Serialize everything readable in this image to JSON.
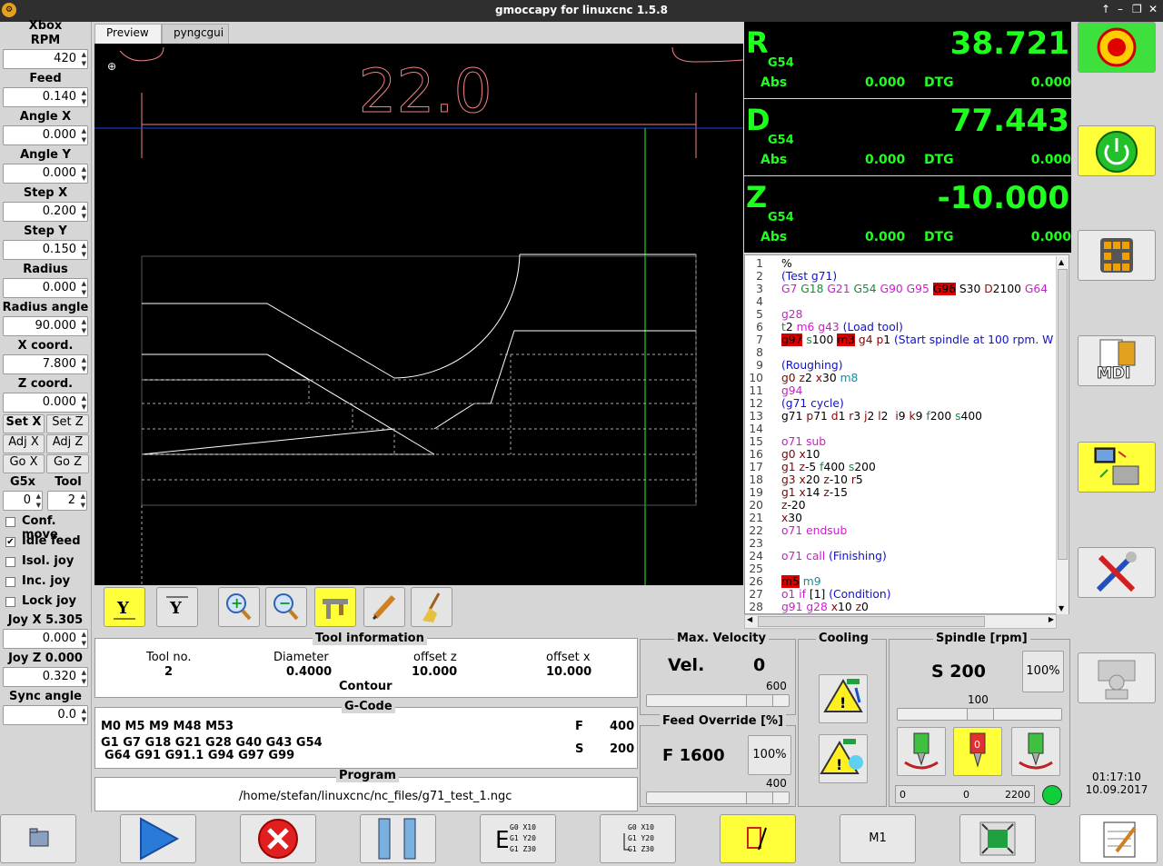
{
  "window": {
    "title": "gmoccapy for linuxcnc  1.5.8",
    "logo": "⚙",
    "controls": [
      "↑",
      "–",
      "❐",
      "✕"
    ]
  },
  "left": {
    "xbox": "Xbox",
    "rpm_label": "RPM",
    "rpm": "420",
    "feed_label": "Feed",
    "feed": "0.140",
    "anglex_label": "Angle X",
    "anglex": "0.000",
    "angley_label": "Angle Y",
    "angley": "0.000",
    "stepx_label": "Step X",
    "stepx": "0.200",
    "stepy_label": "Step Y",
    "stepy": "0.150",
    "radius_label": "Radius",
    "radius": "0.000",
    "radang_label": "Radius angle",
    "radang": "90.000",
    "xcoord_label": "X coord.",
    "xcoord": "7.800",
    "zcoord_label": "Z coord.",
    "zcoord": "0.000",
    "setx": "Set X",
    "setz": "Set Z",
    "adjx": "Adj X",
    "adjz": "Adj Z",
    "gox": "Go X",
    "goz": "Go Z",
    "g5x_label": "G5x",
    "g5x": "0",
    "tool_label": "Tool",
    "tool": "2",
    "conf": "Conf. move",
    "idle": "Idle feed",
    "isol": "Isol. joy",
    "inc": "Inc. joy",
    "lock": "Lock joy",
    "joyx_label": "Joy X 5.305",
    "joyx": "0.000",
    "joyz_label": "Joy Z 0.000",
    "joyz": "0.320",
    "sync_label": "Sync angle",
    "sync": "0.0"
  },
  "tabs": [
    "Preview",
    "pyngcgui"
  ],
  "preview": {
    "dimension": "22.0"
  },
  "dro": [
    {
      "axis": "R",
      "offset": "G54",
      "value": "38.721",
      "abs_label": "Abs",
      "abs": "0.000",
      "dtg_label": "DTG",
      "dtg": "0.000"
    },
    {
      "axis": "D",
      "offset": "G54",
      "value": "77.443",
      "abs_label": "Abs",
      "abs": "0.000",
      "dtg_label": "DTG",
      "dtg": "0.000"
    },
    {
      "axis": "Z",
      "offset": "G54",
      "value": "-10.000",
      "abs_label": "Abs",
      "abs": "0.000",
      "dtg_label": "DTG",
      "dtg": "0.000"
    }
  ],
  "gcode_lines": [
    [
      [
        "bk",
        "%"
      ]
    ],
    [
      [
        "bl",
        "(Test g71)"
      ]
    ],
    [
      [
        "mg",
        "G7 "
      ],
      [
        "gn",
        "G18 "
      ],
      [
        "mg",
        "G21 "
      ],
      [
        "gn",
        "G54 "
      ],
      [
        "mg",
        "G90 G95 "
      ],
      [
        "hl",
        "G96"
      ],
      [
        "bk",
        " S30 "
      ],
      [
        "rd",
        "D"
      ],
      [
        "bk",
        "2100 "
      ],
      [
        "mg",
        "G64"
      ]
    ],
    [],
    [
      [
        "mg",
        "g28"
      ]
    ],
    [
      [
        "gn",
        "t"
      ],
      [
        "bk",
        "2 "
      ],
      [
        "mg",
        "m6 g43 "
      ],
      [
        "bl",
        "(Load tool)"
      ]
    ],
    [
      [
        "hl",
        "g97"
      ],
      [
        "bk",
        " "
      ],
      [
        "gn",
        "s"
      ],
      [
        "bk",
        "100 "
      ],
      [
        "hl",
        "m3"
      ],
      [
        "bk",
        " "
      ],
      [
        "dr",
        "g4 p"
      ],
      [
        "bk",
        "1 "
      ],
      [
        "bl",
        "(Start spindle at 100 rpm. W"
      ]
    ],
    [],
    [
      [
        "bl",
        "(Roughing)"
      ]
    ],
    [
      [
        "dr",
        "g0 z"
      ],
      [
        "bk",
        "2 "
      ],
      [
        "dr",
        "x"
      ],
      [
        "bk",
        "30 "
      ],
      [
        "tl",
        "m8"
      ]
    ],
    [
      [
        "mg",
        "g94"
      ]
    ],
    [
      [
        "bl",
        "(g71 cycle)"
      ]
    ],
    [
      [
        "bk",
        "g71 "
      ],
      [
        "dr",
        "p"
      ],
      [
        "bk",
        "71 "
      ],
      [
        "dr",
        "d"
      ],
      [
        "bk",
        "1 "
      ],
      [
        "dr",
        "r"
      ],
      [
        "bk",
        "3 "
      ],
      [
        "dr",
        "j"
      ],
      [
        "bk",
        "2 "
      ],
      [
        "dr",
        "l"
      ],
      [
        "bk",
        "2  "
      ],
      [
        "dr",
        "i"
      ],
      [
        "bk",
        "9 "
      ],
      [
        "dr",
        "k"
      ],
      [
        "bk",
        "9 "
      ],
      [
        "gn",
        "f"
      ],
      [
        "bk",
        "200 "
      ],
      [
        "gn",
        "s"
      ],
      [
        "bk",
        "400"
      ]
    ],
    [],
    [
      [
        "mg",
        "o71 sub"
      ]
    ],
    [
      [
        "dr",
        "g0 x"
      ],
      [
        "bk",
        "10"
      ]
    ],
    [
      [
        "dr",
        "g1 z"
      ],
      [
        "bk",
        "-5 "
      ],
      [
        "gn",
        "f"
      ],
      [
        "bk",
        "400 "
      ],
      [
        "gn",
        "s"
      ],
      [
        "bk",
        "200"
      ]
    ],
    [
      [
        "dr",
        "g3 x"
      ],
      [
        "bk",
        "20 "
      ],
      [
        "dr",
        "z"
      ],
      [
        "bk",
        "-10 "
      ],
      [
        "dr",
        "r"
      ],
      [
        "bk",
        "5"
      ]
    ],
    [
      [
        "dr",
        "g1 x"
      ],
      [
        "bk",
        "14 "
      ],
      [
        "dr",
        "z"
      ],
      [
        "bk",
        "-15"
      ]
    ],
    [
      [
        "dr",
        "z"
      ],
      [
        "bk",
        "-20"
      ]
    ],
    [
      [
        "dr",
        "x"
      ],
      [
        "bk",
        "30"
      ]
    ],
    [
      [
        "mg",
        "o71 endsub"
      ]
    ],
    [],
    [
      [
        "mg",
        "o71 call "
      ],
      [
        "bl",
        "(Finishing)"
      ]
    ],
    [],
    [
      [
        "hl",
        "m5"
      ],
      [
        "bk",
        " "
      ],
      [
        "tl",
        "m9"
      ]
    ],
    [
      [
        "mg",
        "o1 if "
      ],
      [
        "bk",
        "[1] "
      ],
      [
        "bl",
        "(Condition)"
      ]
    ],
    [
      [
        "mg",
        "g91 g28 "
      ],
      [
        "dr",
        "x"
      ],
      [
        "bk",
        "10 "
      ],
      [
        "dr",
        "z"
      ],
      [
        "bk",
        "0"
      ]
    ]
  ],
  "toolinfo": {
    "title": "Tool information",
    "h_tool": "Tool no.",
    "h_diam": "Diameter",
    "h_offz": "offset z",
    "h_offx": "offset x",
    "tool": "2",
    "diam": "0.4000",
    "offz": "10.000",
    "offx": "10.000",
    "contour": "Contour"
  },
  "gcodeinfo": {
    "title": "G-Code",
    "line1": "M0 M5 M9 M48 M53",
    "line2": "G1 G7 G18 G21 G28 G40 G43 G54",
    "line3": "G64 G91 G91.1 G94 G97 G99",
    "f_label": "F",
    "f": "400",
    "s_label": "S",
    "s": "200"
  },
  "program": {
    "title": "Program",
    "path": "/home/stefan/linuxcnc/nc_files/g71_test_1.ngc"
  },
  "velocity": {
    "title": "Max. Velocity",
    "label": "Vel.",
    "value": "0",
    "max": "600",
    "fraction": 0.85
  },
  "feedov": {
    "title": "Feed Override [%]",
    "value": "F  1600",
    "pct": "100%",
    "max": "400",
    "fraction": 0.85
  },
  "cooling": {
    "title": "Cooling"
  },
  "spindle": {
    "title": "Spindle [rpm]",
    "value": "S 200",
    "pct": "100%",
    "scale": "100",
    "bar_min": "0",
    "bar_mid": "0",
    "bar_max": "2200"
  },
  "clock": {
    "time": "01:17:10",
    "date": "10.09.2017"
  },
  "bottom": {
    "m1": "M1"
  }
}
